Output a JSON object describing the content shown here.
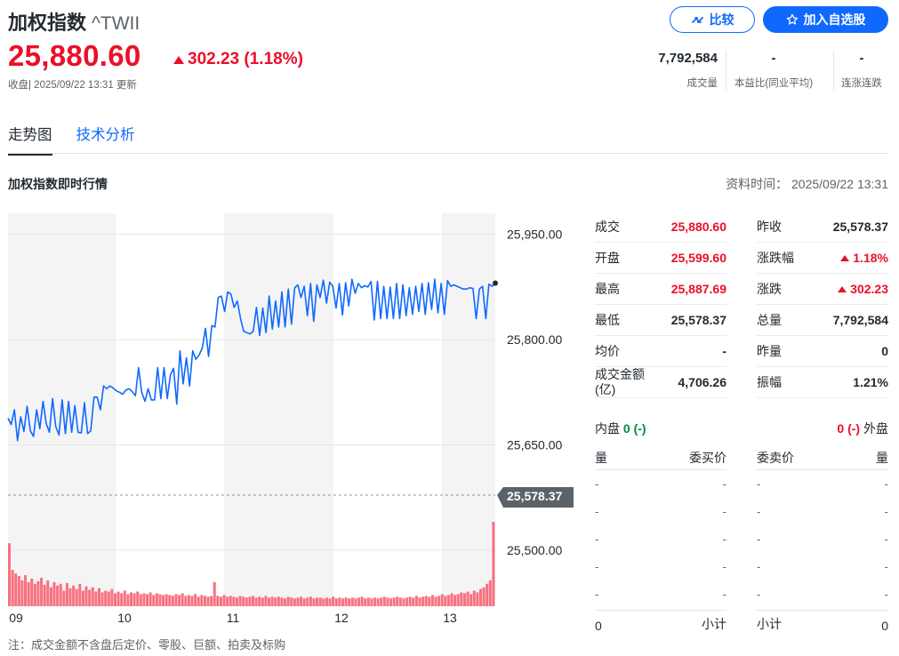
{
  "header": {
    "name": "加权指数",
    "symbol": "^TWII",
    "compare_label": "比较",
    "watch_label": "加入自选股",
    "price": "25,880.60",
    "change": "302.23 (1.18%)",
    "status": "收盘| 2025/09/22 13:31 更新"
  },
  "stats": [
    {
      "value": "7,792,584",
      "label": "成交量"
    },
    {
      "value": "-",
      "label": "本益比(同业平均)"
    },
    {
      "value": "-",
      "label": "连涨连跌"
    }
  ],
  "tabs": [
    {
      "label": "走势图"
    },
    {
      "label": "技术分析"
    }
  ],
  "section": {
    "title": "加权指数即时行情",
    "time": "资料时间： 2025/09/22 13:31"
  },
  "chart_data": {
    "type": "line",
    "y_ticks": [
      "25,950.00",
      "25,800.00",
      "25,650.00",
      "25,500.00"
    ],
    "x_ticks": [
      "09",
      "10",
      "11",
      "12",
      "13"
    ],
    "ylim": [
      25420,
      25980
    ],
    "reference_label": "25,578.37",
    "reference_value": 25578.37,
    "last_value": 25880.6,
    "series": [
      {
        "values": [
          25688,
          25679,
          25700,
          25656,
          25690,
          25669,
          25705,
          25670,
          25662,
          25700,
          25673,
          25712,
          25680,
          25668,
          25716,
          25676,
          25664,
          25714,
          25666,
          25712,
          25668,
          25706,
          25668,
          25667,
          25710,
          25666,
          25670,
          25718,
          25718,
          25700,
          25734,
          25730,
          25734,
          25731,
          25727,
          25725,
          25722,
          25728,
          25730,
          25726,
          25720,
          25760,
          25725,
          25712,
          25730,
          25714,
          25714,
          25760,
          25716,
          25760,
          25716,
          25750,
          25759,
          25708,
          25784,
          25737,
          25774,
          25734,
          25784,
          25772,
          25778,
          25788,
          25816,
          25776,
          25820,
          25818,
          25860,
          25862,
          25840,
          25868,
          25865,
          25846,
          25855,
          25830,
          25812,
          25810,
          25808,
          25812,
          25846,
          25806,
          25845,
          25810,
          25862,
          25815,
          25855,
          25818,
          25868,
          25818,
          25872,
          25822,
          25874,
          25878,
          25860,
          25876,
          25834,
          25880,
          25826,
          25878,
          25860,
          25885,
          25852,
          25882,
          25876,
          25845,
          25880,
          25835,
          25881,
          25848,
          25886,
          25866,
          25880,
          25874,
          25877,
          25875,
          25883,
          25828,
          25883,
          25830,
          25876,
          25830,
          25875,
          25830,
          25880,
          25830,
          25878,
          25834,
          25874,
          25836,
          25876,
          25840,
          25880,
          25836,
          25881,
          25843,
          25886,
          25838,
          25880,
          25836,
          25884,
          25876,
          25878,
          25876,
          25874,
          25872,
          25872,
          25874,
          25873,
          25830,
          25872,
          25876,
          25830,
          25879,
          25876,
          25880
        ]
      }
    ],
    "volume": [
      73,
      42,
      38,
      35,
      30,
      36,
      28,
      32,
      26,
      29,
      33,
      25,
      30,
      22,
      28,
      24,
      26,
      18,
      27,
      21,
      24,
      20,
      26,
      18,
      23,
      19,
      22,
      17,
      21,
      16,
      18,
      17,
      20,
      15,
      17,
      15,
      18,
      14,
      16,
      15,
      17,
      14,
      15,
      14,
      16,
      13,
      15,
      14,
      13,
      14,
      13,
      12,
      14,
      13,
      15,
      12,
      13,
      12,
      14,
      11,
      13,
      12,
      11,
      12,
      28,
      12,
      11,
      13,
      11,
      12,
      11,
      10,
      12,
      11,
      10,
      11,
      12,
      10,
      11,
      10,
      12,
      10,
      11,
      10,
      11,
      10,
      9,
      11,
      10,
      9,
      10,
      11,
      9,
      10,
      11,
      9,
      10,
      10,
      9,
      10,
      9,
      11,
      9,
      10,
      9,
      10,
      9,
      10,
      9,
      10,
      11,
      9,
      10,
      9,
      10,
      9,
      10,
      11,
      10,
      9,
      10,
      11,
      10,
      9,
      10,
      11,
      10,
      12,
      10,
      11,
      12,
      11,
      13,
      11,
      12,
      14,
      12,
      13,
      15,
      13,
      14,
      16,
      15,
      17,
      14,
      18,
      16,
      20,
      22,
      26,
      30,
      98
    ]
  },
  "note": "注：成交金额不含盘后定价、零股、巨额、拍卖及标购",
  "quote_left": [
    {
      "label": "成交",
      "value": "25,880.60",
      "red": true
    },
    {
      "label": "开盘",
      "value": "25,599.60",
      "red": true
    },
    {
      "label": "最高",
      "value": "25,887.69",
      "red": true
    },
    {
      "label": "最低",
      "value": "25,578.37",
      "red": false
    },
    {
      "label": "均价",
      "value": "-",
      "red": false
    },
    {
      "label": "成交金额(亿)",
      "value": "4,706.26",
      "red": false
    }
  ],
  "quote_right": [
    {
      "label": "昨收",
      "value": "25,578.37",
      "red": false
    },
    {
      "label": "涨跌幅",
      "value": "1.18%",
      "red": true
    },
    {
      "label": "涨跌",
      "value": "302.23",
      "red": true
    },
    {
      "label": "总量",
      "value": "7,792,584",
      "red": false
    },
    {
      "label": "昨量",
      "value": "0",
      "red": false
    },
    {
      "label": "振幅",
      "value": "1.21%",
      "red": false
    }
  ],
  "orderbook": {
    "inner_label": "内盘",
    "inner_value": "0",
    "inner_pct": "(-)",
    "outer_label": "外盘",
    "outer_value": "0",
    "outer_pct": "(-)",
    "bid_headers": [
      "量",
      "委买价"
    ],
    "ask_headers": [
      "委卖价",
      "量"
    ],
    "rows": [
      "-",
      "-",
      "-",
      "-",
      "-"
    ],
    "bid_total": "0",
    "subtotal_label": "小计",
    "ask_total": "0"
  }
}
